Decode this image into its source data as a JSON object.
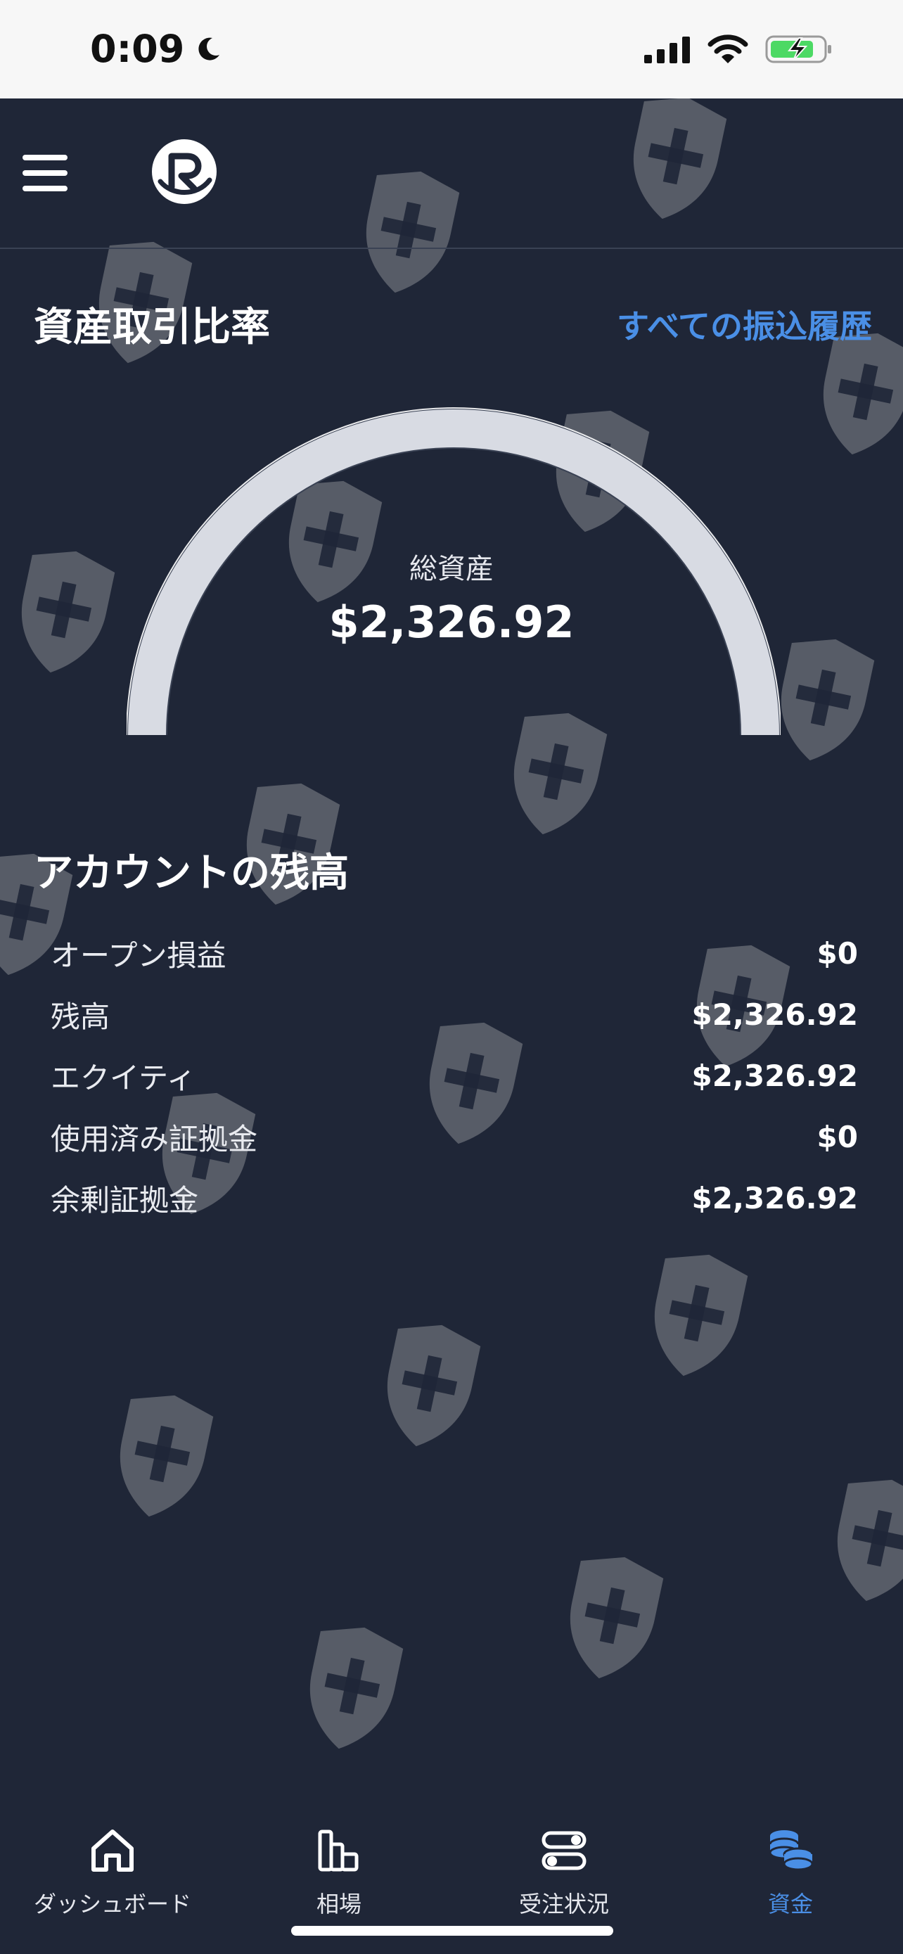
{
  "status_bar": {
    "time": "0:09",
    "icons": [
      "moon-icon",
      "cellular-signal-icon",
      "wifi-icon",
      "battery-charging-icon"
    ]
  },
  "header": {
    "menu_icon": "hamburger-icon",
    "logo_icon": "r-logo-icon"
  },
  "asset_section": {
    "title": "資産取引比率",
    "link": "すべての振込履歴"
  },
  "gauge": {
    "label": "総資産",
    "value": "$2,326.92",
    "fill_fraction": 1.0,
    "color": "#d8dbe3"
  },
  "balance_section": {
    "title": "アカウントの残高",
    "rows": [
      {
        "label": "オープン損益",
        "value": "$0"
      },
      {
        "label": "残高",
        "value": "$2,326.92"
      },
      {
        "label": "エクイティ",
        "value": "$2,326.92"
      },
      {
        "label": "使用済み証拠金",
        "value": "$0"
      },
      {
        "label": "余剰証拠金",
        "value": "$2,326.92"
      }
    ]
  },
  "bottom_nav": {
    "items": [
      {
        "label": "ダッシュボード",
        "icon": "home-icon",
        "active": false
      },
      {
        "label": "相場",
        "icon": "bar-chart-icon",
        "active": false
      },
      {
        "label": "受注状況",
        "icon": "toggles-icon",
        "active": false
      },
      {
        "label": "資金",
        "icon": "coins-stack-icon",
        "active": true
      }
    ]
  },
  "colors": {
    "background": "#1f2637",
    "accent": "#4a8fe6",
    "status_bar": "#f7f7f7",
    "battery_charge": "#4cd964"
  }
}
